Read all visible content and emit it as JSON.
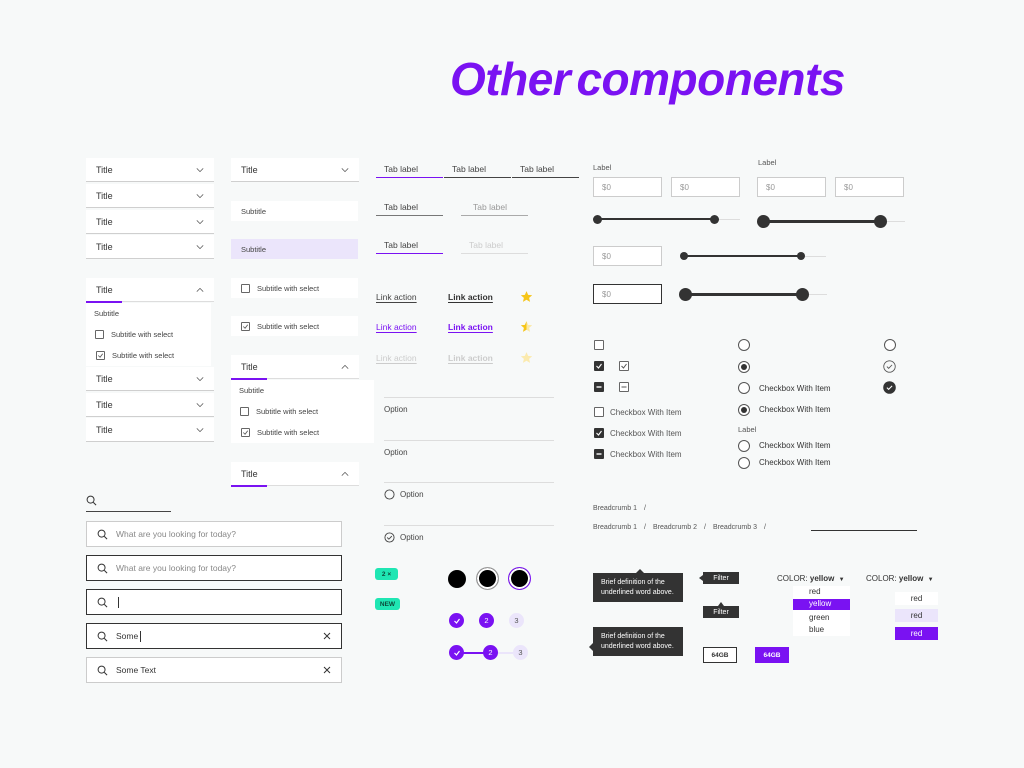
{
  "page_title": "Other components",
  "colors": {
    "accent": "#7a12f2",
    "accent_light": "#ebe5fb",
    "mint": "#1fe6b3",
    "dark": "#333333",
    "background": "#f7f9f9"
  },
  "accordion_col1": {
    "items": [
      "Title",
      "Title",
      "Title",
      "Title"
    ],
    "open": {
      "title": "Title",
      "subtitle": "Subtitle",
      "options": [
        {
          "label": "Subtitle with select",
          "checked": false
        },
        {
          "label": "Subtitle with select",
          "checked": true
        }
      ]
    },
    "after_items": [
      "Title",
      "Title",
      "Title"
    ]
  },
  "accordion_col2": {
    "closed_title": "Title",
    "subtitle_plain": "Subtitle",
    "subtitle_selected": "Subtitle",
    "select_options": [
      {
        "label": "Subtitle with select",
        "checked": false
      },
      {
        "label": "Subtitle with select",
        "checked": true
      }
    ],
    "open": {
      "title": "Title",
      "subtitle": "Subtitle",
      "options": [
        {
          "label": "Subtitle with select",
          "checked": false
        },
        {
          "label": "Subtitle with select",
          "checked": true
        }
      ]
    },
    "open_collapsed_title": "Title"
  },
  "search": {
    "placeholder": "What are you looking for today?",
    "field4_value": "Some",
    "field5_value": "Some Text"
  },
  "tabs": {
    "row1": [
      "Tab label",
      "Tab label",
      "Tab label"
    ],
    "row2": [
      "Tab label",
      "Tab label"
    ],
    "row3": [
      "Tab label",
      "Tab label"
    ]
  },
  "links": {
    "label": "Link action",
    "rows": [
      {
        "regular": "Link action",
        "bold": "Link action",
        "rating": 1
      },
      {
        "regular": "Link action",
        "bold": "Link action",
        "rating": 0.5
      },
      {
        "regular": "Link action",
        "bold": "Link action",
        "rating": 0
      }
    ]
  },
  "options": [
    {
      "label": "Option",
      "type": "plain"
    },
    {
      "label": "Option",
      "type": "plain"
    },
    {
      "label": "Option",
      "type": "radio"
    },
    {
      "label": "Option",
      "type": "check"
    }
  ],
  "tags": {
    "chip": "2",
    "chip_close": "×",
    "badge": "NEW"
  },
  "stepper": {
    "steps": [
      "2",
      "3"
    ],
    "current": 2
  },
  "range": {
    "label1": "Label",
    "label2": "Label",
    "value": "$0",
    "slider_low": 0,
    "slider_high": 0.8
  },
  "checkboxes": {
    "item_label": "Checkbox With Item",
    "radio_label": "Label"
  },
  "breadcrumbs": {
    "single": [
      "Breadcrumb 1"
    ],
    "multi": [
      "Breadcrumb 1",
      "Breadcrumb 2",
      "Breadcrumb 3"
    ],
    "separator": "/"
  },
  "tooltips": {
    "definition": "Brief definition of the underlined word above.",
    "filter": "Filter"
  },
  "storage": {
    "outline": "64GB",
    "filled": "64GB"
  },
  "color_select": {
    "label": "COLOR:",
    "value": "yellow",
    "options": [
      "red",
      "yellow",
      "green",
      "blue"
    ],
    "alt_options": [
      "red",
      "red",
      "red"
    ]
  }
}
